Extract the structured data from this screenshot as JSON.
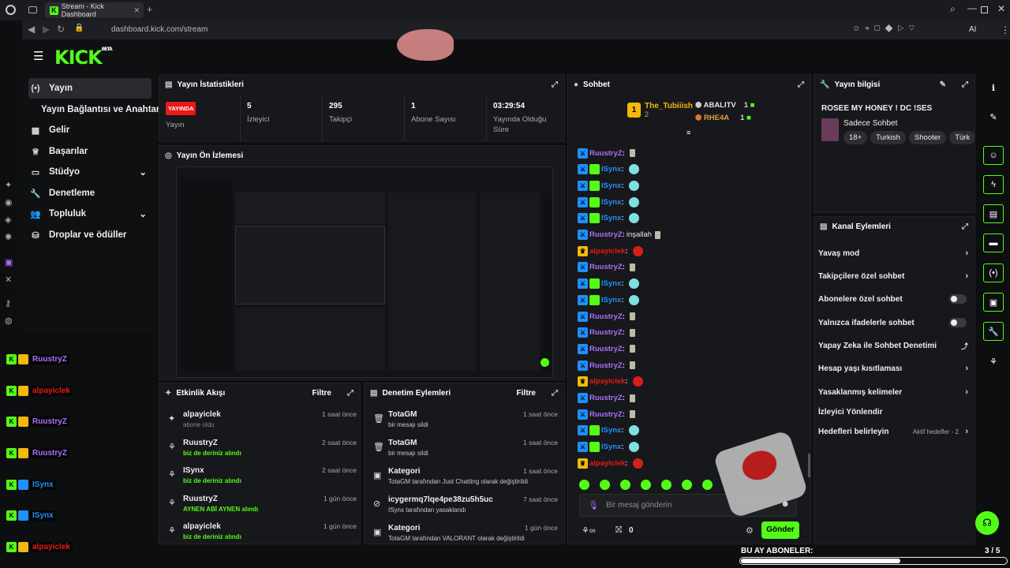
{
  "browser": {
    "tab_title": "Stream - Kick Dashboard",
    "url": "dashboard.kick.com/stream",
    "ai_label": "AI"
  },
  "logo": {
    "text": "KICK",
    "beta": "BETA"
  },
  "sidebar": {
    "items": [
      {
        "label": "Yayın",
        "icon": "broadcast-icon"
      },
      {
        "label": "Yayın Bağlantısı ve Anahtarı",
        "icon": ""
      },
      {
        "label": "Gelir",
        "icon": "revenue-icon"
      },
      {
        "label": "Başarılar",
        "icon": "trophy-icon"
      },
      {
        "label": "Stüdyo",
        "icon": "studio-icon"
      },
      {
        "label": "Denetleme",
        "icon": "wrench-icon"
      },
      {
        "label": "Topluluk",
        "icon": "community-icon"
      },
      {
        "label": "Droplar ve ödüller",
        "icon": "drops-icon"
      }
    ]
  },
  "stats": {
    "title": "Yayın İstatistikleri",
    "live_badge": "YAYINDA",
    "live_label": "Yayın",
    "viewers_value": "5",
    "viewers_label": "İzleyici",
    "followers_value": "295",
    "followers_label": "Takipçi",
    "subs_value": "1",
    "subs_label": "Abone Sayısı",
    "duration_value": "03:29:54",
    "duration_label": "Yayında Olduğu Süre"
  },
  "preview": {
    "title": "Yayın Ön İzlemesi"
  },
  "activity": {
    "title": "Etkinlik Akışı",
    "filter": "Filtre",
    "rows": [
      {
        "name": "alpayiclek",
        "sub": "abone oldu",
        "time": "1 saat önce"
      },
      {
        "name": "RuustryZ",
        "sub": "biz de deriniz alındı",
        "time": "2 saat önce"
      },
      {
        "name": "ISynx",
        "sub": "biz de deriniz alındı",
        "time": "2 saat önce"
      },
      {
        "name": "RuustryZ",
        "sub": "AYNEN ABİ AYNEN alındı",
        "time": "1 gün önce"
      },
      {
        "name": "alpayiclek",
        "sub": "biz de deriniz alındı",
        "time": "1 gün önce"
      }
    ]
  },
  "moderation": {
    "title": "Denetim Eylemleri",
    "filter": "Filtre",
    "rows": [
      {
        "name": "TotaGM",
        "sub": "bir mesajı sildi",
        "time": "1 saat önce"
      },
      {
        "name": "TotaGM",
        "sub": "bir mesajı sildi",
        "time": "1 saat önce"
      },
      {
        "name": "Kategori",
        "sub": "TotaGM tarafından Just Chatting olarak değiştirildi",
        "time": "1 saat önce"
      },
      {
        "name": "icygermq7lqe4pe38zu5h5uc",
        "sub": "ISynx tarafından yasaklandı",
        "time": "7 saat önce"
      },
      {
        "name": "Kategori",
        "sub": "TotaGM tarafından VALORANT olarak değiştirildi",
        "time": "1 gün önce"
      }
    ]
  },
  "chat": {
    "title": "Sohbet",
    "top1_name": "The_Tubiiish",
    "top1_count": "2",
    "top2_name": "ABALITV",
    "top2_count": "1",
    "top3_name": "RHE4A",
    "top3_count": "1",
    "messages": [
      {
        "user": "RuustryZ",
        "text": "",
        "color": "#a970ff"
      },
      {
        "user": "ISynx",
        "text": "",
        "color": "#1e90ff"
      },
      {
        "user": "ISynx",
        "text": "",
        "color": "#1e90ff"
      },
      {
        "user": "ISynx",
        "text": "",
        "color": "#1e90ff"
      },
      {
        "user": "ISynx",
        "text": "",
        "color": "#1e90ff"
      },
      {
        "user": "RuustryZ",
        "text": "inşallah",
        "color": "#a970ff"
      },
      {
        "user": "alpayiclek",
        "text": "",
        "color": "#e91916"
      },
      {
        "user": "RuustryZ",
        "text": "",
        "color": "#a970ff"
      },
      {
        "user": "ISynx",
        "text": "",
        "color": "#1e90ff"
      },
      {
        "user": "ISynx",
        "text": "",
        "color": "#1e90ff"
      },
      {
        "user": "RuustryZ",
        "text": "",
        "color": "#a970ff"
      },
      {
        "user": "RuustryZ",
        "text": "",
        "color": "#a970ff"
      },
      {
        "user": "RuustryZ",
        "text": "",
        "color": "#a970ff"
      },
      {
        "user": "RuustryZ",
        "text": "",
        "color": "#a970ff"
      },
      {
        "user": "alpayiclek",
        "text": "",
        "color": "#e91916"
      },
      {
        "user": "RuustryZ",
        "text": "",
        "color": "#a970ff"
      },
      {
        "user": "RuustryZ",
        "text": "",
        "color": "#a970ff"
      },
      {
        "user": "ISynx",
        "text": "",
        "color": "#1e90ff"
      },
      {
        "user": "ISynx",
        "text": "",
        "color": "#1e90ff"
      },
      {
        "user": "alpayiclek",
        "text": "",
        "color": "#e91916"
      }
    ],
    "input_placeholder": "Bir mesaj gönderin",
    "points": "0",
    "send_label": "Gönder"
  },
  "stream_info": {
    "title": "Yayın bilgisi",
    "stream_title": "ROSEE MY HONEY ! DC !SES",
    "category": "Sadece Sohbet",
    "tags": [
      "18+",
      "Turkish",
      "Shooter",
      "Türk"
    ]
  },
  "channel_actions": {
    "title": "Kanal Eylemleri",
    "items": [
      {
        "label": "Yavaş mod",
        "type": "chevron"
      },
      {
        "label": "Takipçilere özel sohbet",
        "type": "chevron"
      },
      {
        "label": "Abonelere özel sohbet",
        "type": "toggle"
      },
      {
        "label": "Yalnızca ifadelerle sohbet",
        "type": "toggle"
      },
      {
        "label": "Yapay Zeka ile Sohbet Denetimi",
        "type": "external"
      },
      {
        "label": "Hesap yaşı kısıtlaması",
        "type": "chevron"
      },
      {
        "label": "Yasaklanmış kelimeler",
        "type": "chevron"
      },
      {
        "label": "İzleyici Yönlendir",
        "type": "none"
      },
      {
        "label": "Hedefleri belirleyin",
        "type": "chevron"
      }
    ],
    "goals_status": "Aktif hedefler - 2"
  },
  "overlay_chat": [
    {
      "user": "RuustryZ",
      "color": "#a970ff"
    },
    {
      "user": "alpayiclek",
      "color": "#e91916"
    },
    {
      "user": "RuustryZ",
      "color": "#a970ff"
    },
    {
      "user": "RuustryZ",
      "color": "#a970ff"
    },
    {
      "user": "ISynx",
      "color": "#1e90ff"
    },
    {
      "user": "ISynx",
      "color": "#1e90ff"
    },
    {
      "user": "alpayiclek",
      "color": "#e91916"
    }
  ],
  "sub_goal": {
    "label": "BU AY ABONELER:",
    "progress": "3 / 5",
    "fraction": 0.6
  },
  "colors": {
    "accent": "#53fc18",
    "live": "#e91916"
  }
}
